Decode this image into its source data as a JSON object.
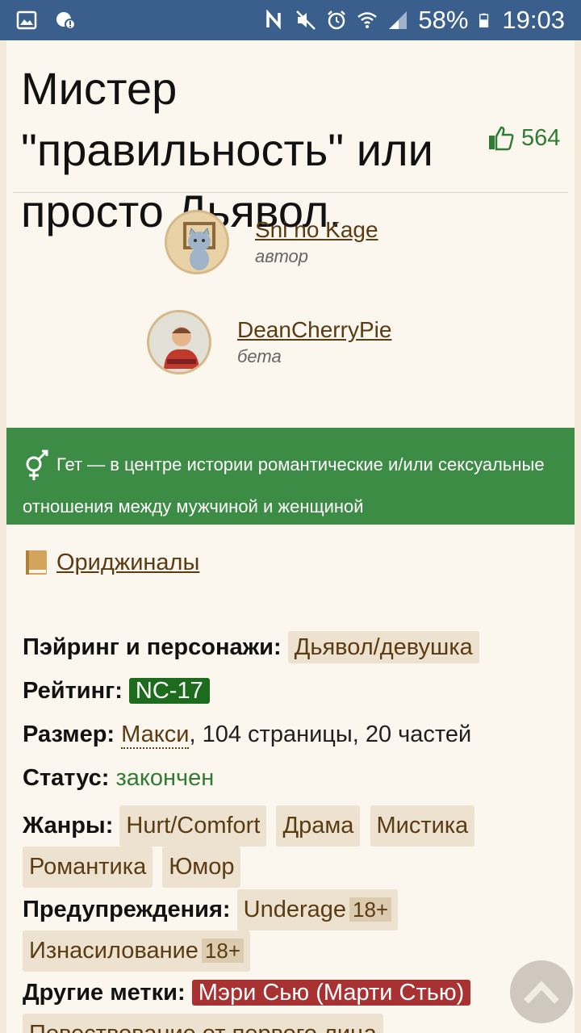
{
  "status_bar": {
    "battery": "58%",
    "time": "19:03"
  },
  "fic": {
    "title": "Мистер \"правильность\" или просто Дьявол.",
    "likes": "564"
  },
  "people": [
    {
      "name": "Sni no Kage",
      "role": "автор"
    },
    {
      "name": "DeanCherryPie",
      "role": "бета"
    }
  ],
  "direction": {
    "text": "Гет — в центре истории романтические и/или сексуальные отношения между мужчиной и женщиной"
  },
  "fandom": {
    "label": "Ориджиналы"
  },
  "details": {
    "pairing_label": "Пэйринг и персонажи:",
    "pairing_value": "Дьявол/девушка",
    "rating_label": "Рейтинг:",
    "rating_value": "NC-17",
    "size_label": "Размер:",
    "size_link": "Макси",
    "size_rest": ", 104 страницы, 20 частей",
    "status_label": "Статус:",
    "status_value": "закончен",
    "genres_label": "Жанры:",
    "genres": [
      "Hurt/Comfort",
      "Драма",
      "Мистика",
      "Романтика",
      "Юмор"
    ],
    "warnings_label": "Предупреждения:",
    "warnings": [
      {
        "name": "Underage",
        "age": "18+"
      },
      {
        "name": "Изнасилование",
        "age": "18+"
      }
    ],
    "other_label": "Другие метки:",
    "other_tags": [
      "Мэри Сью (Марти Стью)",
      "Повествование от первого лица"
    ]
  },
  "colors": {
    "status_bar": "#3a5f8c",
    "banner": "#3d8c45",
    "rating": "#1d6b1d",
    "red_tag": "#a83232",
    "link": "#5a3b12"
  }
}
